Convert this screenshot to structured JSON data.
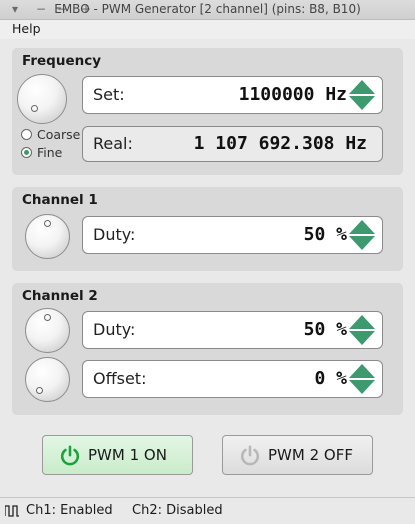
{
  "window": {
    "title": "EMBO - PWM Generator [2 channel] (pins: B8, B10)",
    "controls": [
      "−",
      "−",
      "+"
    ]
  },
  "menu": {
    "help": "Help"
  },
  "frequency": {
    "title": "Frequency",
    "set_label": "Set:",
    "set_value": "1100000 Hz",
    "real_label": "Real:",
    "real_value": "1 107 692.308 Hz",
    "coarse_label": "Coarse",
    "fine_label": "Fine",
    "mode_selected": "fine"
  },
  "channel1": {
    "title": "Channel 1",
    "duty_label": "Duty:",
    "duty_value": "50 %"
  },
  "channel2": {
    "title": "Channel 2",
    "duty_label": "Duty:",
    "duty_value": "50 %",
    "offset_label": "Offset:",
    "offset_value": "0 %"
  },
  "buttons": {
    "pwm1": "PWM 1 ON",
    "pwm2": "PWM 2 OFF"
  },
  "status": {
    "ch1": "Ch1: Enabled",
    "ch2": "Ch2: Disabled"
  },
  "colors": {
    "accent_green": "#3c9a6e",
    "power_on": "#1aa33a",
    "power_off": "#b8b8b8"
  }
}
